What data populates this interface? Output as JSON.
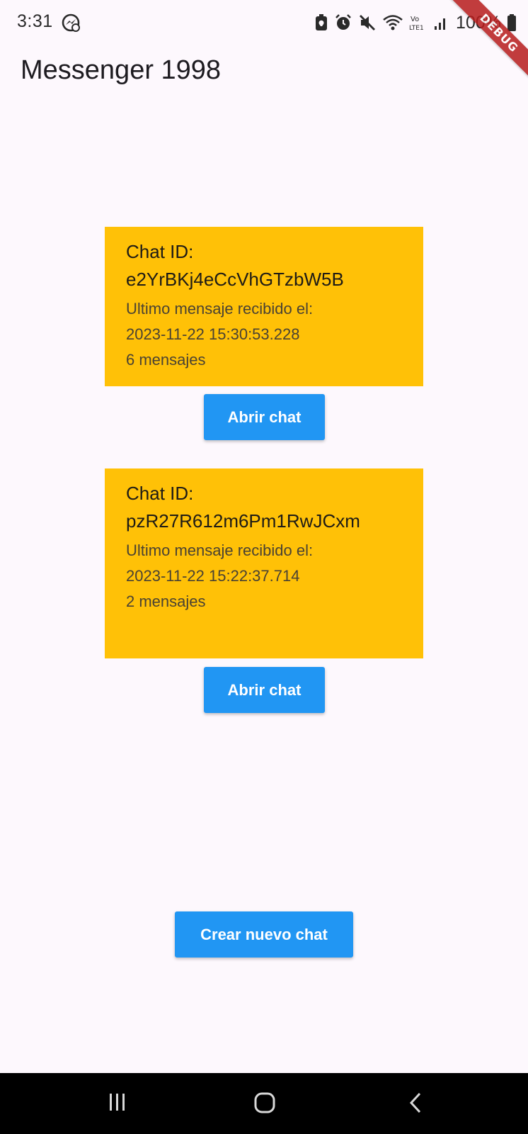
{
  "status_bar": {
    "time": "3:31",
    "battery_percent": "100%",
    "icons": [
      "messenger-icon",
      "battery-saver-icon",
      "alarm-icon",
      "mute-icon",
      "wifi-icon",
      "volte-icon",
      "signal-icon",
      "battery-icon"
    ]
  },
  "debug_banner": "DEBUG",
  "app_bar": {
    "title": "Messenger 1998"
  },
  "chats": [
    {
      "id_label": "Chat ID:",
      "id": "e2YrBKj4eCcVhGTzbW5B",
      "last_message_label": "Ultimo mensaje recibido el:",
      "last_message_time": "2023-11-22 15:30:53.228",
      "message_count": "6 mensajes",
      "open_button": "Abrir chat"
    },
    {
      "id_label": "Chat ID:",
      "id": "pzR27R612m6Pm1RwJCxm",
      "last_message_label": "Ultimo mensaje recibido el:",
      "last_message_time": "2023-11-22 15:22:37.714",
      "message_count": "2 mensajes",
      "open_button": "Abrir chat"
    }
  ],
  "new_chat_button": "Crear nuevo chat",
  "colors": {
    "background": "#fdf8fd",
    "card": "#ffc107",
    "button": "#2196f3",
    "button_text": "#ffffff",
    "debug_ribbon": "#b71c1c",
    "nav_bar": "#000000"
  },
  "nav_bar": {
    "icons": [
      "recents-icon",
      "home-icon",
      "back-icon"
    ]
  }
}
